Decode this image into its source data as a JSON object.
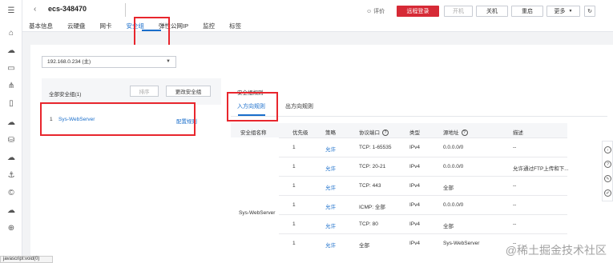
{
  "window": {
    "instance_name": "ecs-348470"
  },
  "header": {
    "tabs": [
      {
        "label": "基本信息",
        "active": false
      },
      {
        "label": "云硬盘",
        "active": false
      },
      {
        "label": "网卡",
        "active": false
      },
      {
        "label": "安全组",
        "active": true
      },
      {
        "label": "弹性公网IP",
        "active": false
      },
      {
        "label": "监控",
        "active": false
      },
      {
        "label": "标签",
        "active": false
      }
    ],
    "feedback_label": "评价",
    "buttons": {
      "remote_login": "远程登录",
      "start": "开机",
      "shutdown": "关机",
      "restart": "重启",
      "more": "更多"
    }
  },
  "content": {
    "ip_select": {
      "value": "192.168.0.234 (主)"
    },
    "security_groups": {
      "title": "全部安全组(1)",
      "sort_label": "排序",
      "change_label": "更改安全组",
      "items": [
        {
          "index": "1",
          "name": "Sys-WebServer",
          "action": "配置规则"
        }
      ]
    },
    "rules": {
      "label": "安全组规则",
      "tabs": [
        {
          "label": "入方向规则",
          "active": true
        },
        {
          "label": "出方向规则",
          "active": false
        }
      ],
      "columns": [
        "安全组名称",
        "优先级",
        "策略",
        "协议端口",
        "类型",
        "源地址",
        "描述"
      ],
      "group_name": "Sys-WebServer",
      "rows": [
        {
          "priority": "1",
          "policy": "允许",
          "protocol": "TCP: 1-65535",
          "type": "IPv4",
          "source": "0.0.0.0/0",
          "desc": "--"
        },
        {
          "priority": "1",
          "policy": "允许",
          "protocol": "TCP: 20-21",
          "type": "IPv4",
          "source": "0.0.0.0/0",
          "desc": "允许通过FTP上传和下..."
        },
        {
          "priority": "1",
          "policy": "允许",
          "protocol": "TCP: 443",
          "type": "IPv4",
          "source": "全部",
          "desc": "--"
        },
        {
          "priority": "1",
          "policy": "允许",
          "protocol": "ICMP: 全部",
          "type": "IPv4",
          "source": "0.0.0.0/0",
          "desc": "--"
        },
        {
          "priority": "1",
          "policy": "允许",
          "protocol": "TCP: 80",
          "type": "IPv4",
          "source": "全部",
          "desc": "--"
        },
        {
          "priority": "1",
          "policy": "允许",
          "protocol": "全部",
          "type": "IPv4",
          "source": "Sys-WebServer",
          "desc": "--"
        }
      ]
    }
  },
  "status_bar": {
    "text": "javascript:void(0)"
  },
  "watermark": "@稀土掘金技术社区",
  "colors": {
    "accent": "#1a6ecb",
    "danger": "#d62a36",
    "highlight": "#e8262d"
  }
}
